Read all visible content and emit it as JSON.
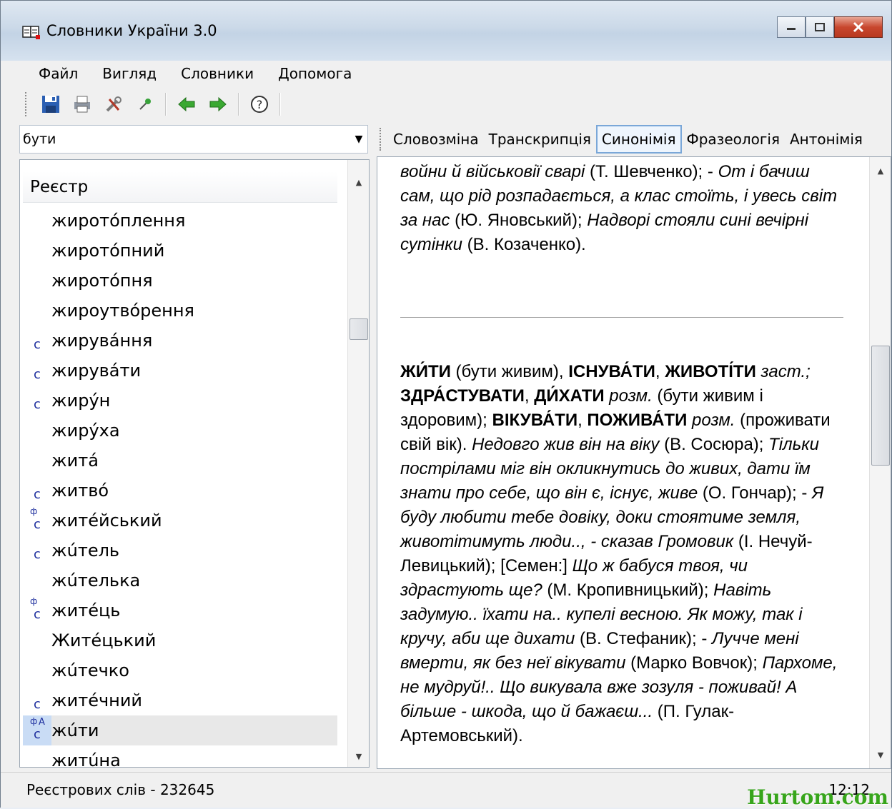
{
  "window": {
    "title": "Словники України 3.0"
  },
  "menu": [
    "Файл",
    "Вигляд",
    "Словники",
    "Допомога"
  ],
  "toolbar": {
    "icons": [
      "save-icon",
      "print-icon",
      "tools-icon",
      "pin-icon",
      "back-arrow-icon",
      "forward-arrow-icon",
      "help-icon"
    ]
  },
  "search": {
    "value": "бути"
  },
  "tabs": [
    "Словозміна",
    "Транскрипція",
    "Синонімія",
    "Фразеологія",
    "Антонімія"
  ],
  "active_tab": "Синонімія",
  "registry": {
    "header": "Реєстр",
    "items": [
      {
        "word": "жиротóплення",
        "marks": ""
      },
      {
        "word": "жиротóпний",
        "marks": ""
      },
      {
        "word": "жиротóпня",
        "marks": ""
      },
      {
        "word": "жироутвóрення",
        "marks": ""
      },
      {
        "word": "жирувáння",
        "marks": "С"
      },
      {
        "word": "жирувáти",
        "marks": "С"
      },
      {
        "word": "жирýн",
        "marks": "С"
      },
      {
        "word": "жирýха",
        "marks": ""
      },
      {
        "word": "житá",
        "marks": ""
      },
      {
        "word": "житвó",
        "marks": "С"
      },
      {
        "word": "житéйський",
        "marks": "ФС"
      },
      {
        "word": "жúтель",
        "marks": "С"
      },
      {
        "word": "жúтелька",
        "marks": ""
      },
      {
        "word": "житéць",
        "marks": "ФС"
      },
      {
        "word": "Житéцький",
        "marks": ""
      },
      {
        "word": "жúтечко",
        "marks": ""
      },
      {
        "word": "житéчний",
        "marks": "С"
      },
      {
        "word": "жúти",
        "marks": "ФАС",
        "selected": true
      },
      {
        "word": "житúна",
        "marks": ""
      }
    ]
  },
  "article_top": [
    {
      "t": "войни й військовії сварі",
      "s": "i"
    },
    {
      "t": " (Т. Шевченко); - ",
      "s": "n"
    },
    {
      "t": "От і бачиш сам, що рід розпадається, а клас стоїть, і увесь світ за нас",
      "s": "i"
    },
    {
      "t": " (Ю. Яновський); ",
      "s": "n"
    },
    {
      "t": "Надворі стояли сині вечірні сутінки",
      "s": "i"
    },
    {
      "t": " (В. Козаченко).",
      "s": "n"
    }
  ],
  "article_main": [
    {
      "t": "ЖИ́ТИ",
      "s": "b"
    },
    {
      "t": " (бути живим), ",
      "s": "n"
    },
    {
      "t": "ІСНУВА́ТИ",
      "s": "b"
    },
    {
      "t": ", ",
      "s": "n"
    },
    {
      "t": "ЖИВОТІ́ТИ",
      "s": "b"
    },
    {
      "t": " ",
      "s": "n"
    },
    {
      "t": "заст.;",
      "s": "i"
    },
    {
      "t": " ",
      "s": "n"
    },
    {
      "t": "ЗДРА́СТУВАТИ",
      "s": "b"
    },
    {
      "t": ", ",
      "s": "n"
    },
    {
      "t": "ДИ́ХАТИ",
      "s": "b"
    },
    {
      "t": " ",
      "s": "n"
    },
    {
      "t": "розм.",
      "s": "i"
    },
    {
      "t": " (бути живим і здоровим); ",
      "s": "n"
    },
    {
      "t": "ВІКУВА́ТИ",
      "s": "b"
    },
    {
      "t": ", ",
      "s": "n"
    },
    {
      "t": "ПОЖИВА́ТИ",
      "s": "b"
    },
    {
      "t": " ",
      "s": "n"
    },
    {
      "t": "розм.",
      "s": "i"
    },
    {
      "t": " (проживати свій вік). ",
      "s": "n"
    },
    {
      "t": "Недовго жив він на віку",
      "s": "i"
    },
    {
      "t": " (В. Сосюра); ",
      "s": "n"
    },
    {
      "t": "Тільки пострілами міг він окликнутись до живих, дати їм знати про себе, що він є, існує, живе",
      "s": "i"
    },
    {
      "t": " (О. Гончар); - ",
      "s": "n"
    },
    {
      "t": "Я буду любити тебе довіку, доки стоятиме земля, животітимуть люди.., - сказав Громовик",
      "s": "i"
    },
    {
      "t": " (І. Нечуй-Левицький); [Семен:] ",
      "s": "n"
    },
    {
      "t": "Що ж бабуся твоя, чи здрастують ще?",
      "s": "i"
    },
    {
      "t": " (М. Кропивницький); ",
      "s": "n"
    },
    {
      "t": "Навіть задумую.. їхати на.. купелі весною. Як можу, так і кручу, аби ще дихати",
      "s": "i"
    },
    {
      "t": " (В. Стефаник); - ",
      "s": "n"
    },
    {
      "t": "Лучче мені вмерти, як без неї вікувати",
      "s": "i"
    },
    {
      "t": " (Марко Вовчок); ",
      "s": "n"
    },
    {
      "t": "Пархоме, не мудруй!.. Що викувала вже зозуля - поживай! А більше - шкода, що й бажаєш...",
      "s": "i"
    },
    {
      "t": " (П. Гулак-Артемовський).",
      "s": "n"
    }
  ],
  "status": {
    "words": "Реєстрових слів - 232645",
    "time": "12:12",
    "watermark": "Hurtom.com"
  }
}
